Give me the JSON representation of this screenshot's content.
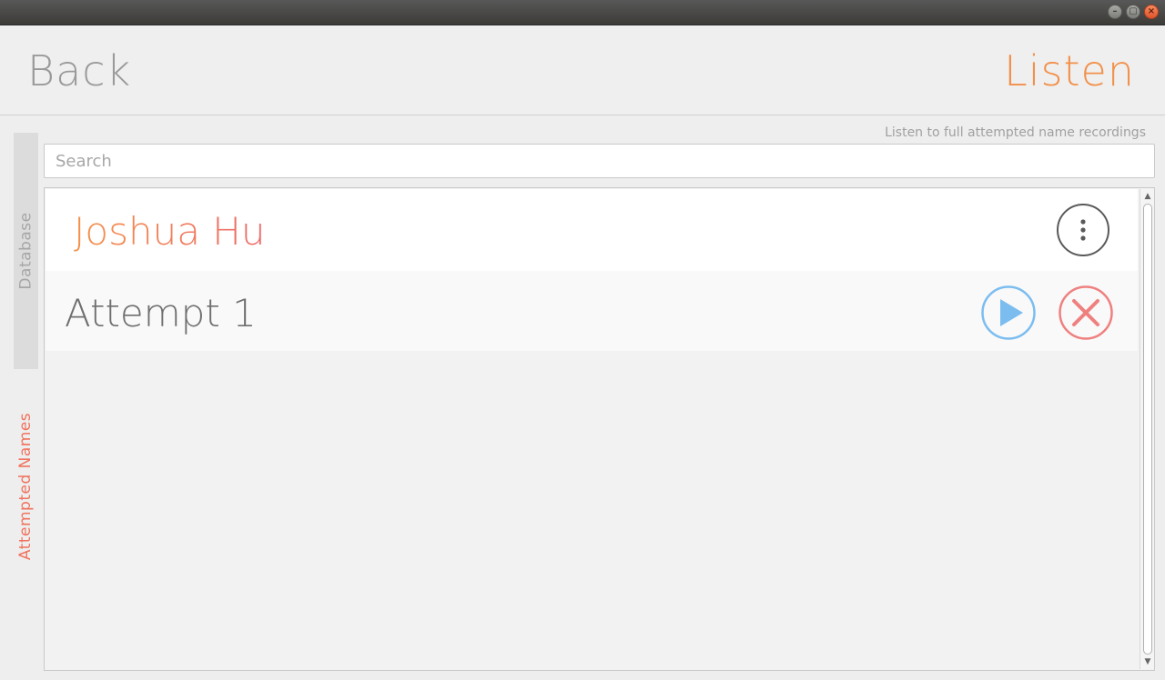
{
  "window": {
    "minimize_icon": "–",
    "maximize_icon": "▢",
    "close_icon": "×"
  },
  "header": {
    "back_label": "Back",
    "title": "Listen"
  },
  "tabs": {
    "database": "Database",
    "attempted_names": "Attempted Names"
  },
  "subtitle": "Listen to full attempted name recordings",
  "search": {
    "placeholder": "Search",
    "value": ""
  },
  "list": {
    "name": "Joshua Hu",
    "attempts": [
      {
        "label": "Attempt 1"
      }
    ]
  },
  "icons": {
    "more": "more-vertical-icon",
    "play": "play-icon",
    "delete": "close-circle-icon"
  },
  "colors": {
    "accent_orange": "#f2904a",
    "accent_red": "#f0725e",
    "play_blue": "#7cbdf0",
    "delete_red": "#ef8080"
  }
}
